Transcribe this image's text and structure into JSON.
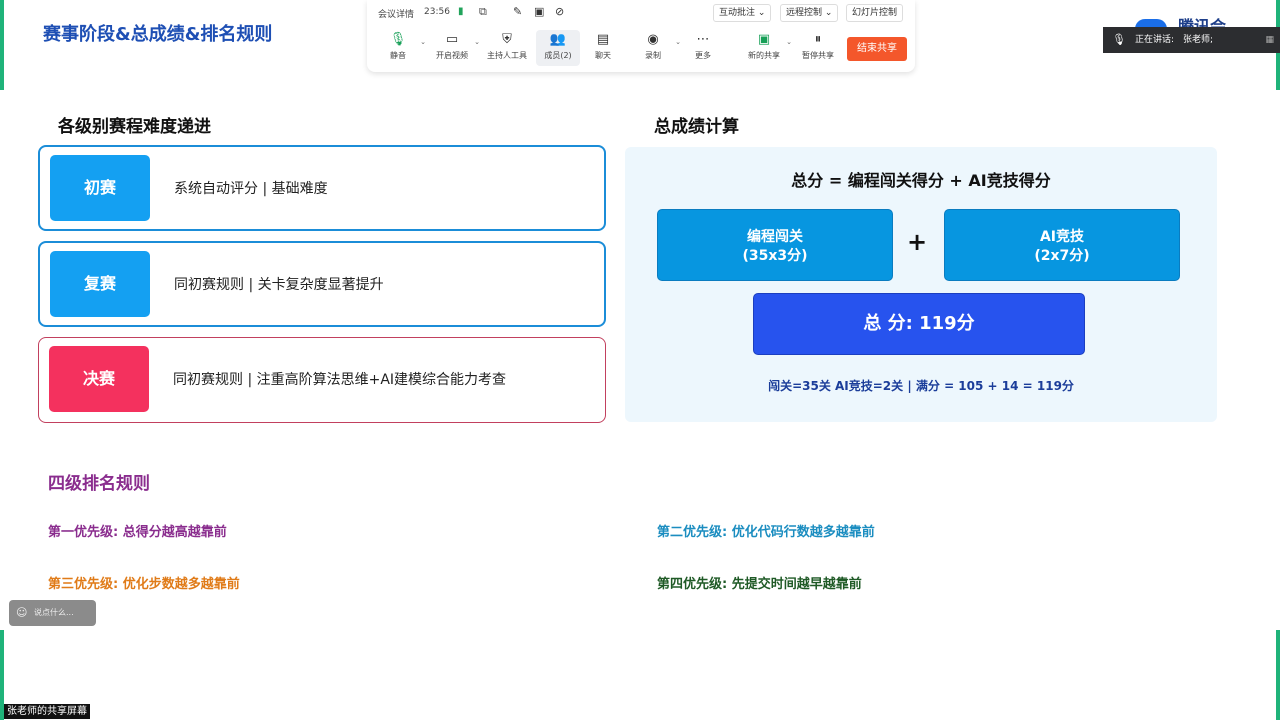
{
  "slide": {
    "title": "赛事阶段&总成绩&排名规则"
  },
  "toolbar": {
    "meeting_details": "会议详情",
    "time": "23:56",
    "annotate": "互动批注",
    "remote_control": "远程控制",
    "slideshow_control": "幻灯片控制",
    "buttons": [
      {
        "label": "静音",
        "icon": "mic-icon"
      },
      {
        "label": "开启视频",
        "icon": "video-off-icon"
      },
      {
        "label": "主持人工具",
        "icon": "shield-icon"
      },
      {
        "label": "成员(2)",
        "icon": "members-icon"
      },
      {
        "label": "聊天",
        "icon": "chat-icon"
      },
      {
        "label": "录制",
        "icon": "record-icon"
      },
      {
        "label": "更多",
        "icon": "more-icon"
      },
      {
        "label": "新的共享",
        "icon": "share-screen-icon"
      },
      {
        "label": "暂停共享",
        "icon": "pause-share-icon"
      }
    ],
    "end_share": "结束共享"
  },
  "speaker": {
    "label": "正在讲话:",
    "name": "张老师;"
  },
  "stages": {
    "heading": "各级别赛程难度递进",
    "items": [
      {
        "tag": "初赛",
        "desc": "系统自动评分 | 基础难度"
      },
      {
        "tag": "复赛",
        "desc": "同初赛规则 | 关卡复杂度显著提升"
      },
      {
        "tag": "决赛",
        "desc": "同初赛规则 | 注重高阶算法思维+AI建模综合能力考查"
      }
    ]
  },
  "score": {
    "heading": "总成绩计算",
    "formula": "总分 = 编程闯关得分 + AI竞技得分",
    "box1_line1": "编程闯关",
    "box1_line2": "(35x3分)",
    "plus": "+",
    "box2_line1": "AI竞技",
    "box2_line2": "(2x7分)",
    "total": "总 分: 119分",
    "note": "闯关=35关  AI竞技=2关  |  满分 = 105 + 14 = 119分"
  },
  "ranking": {
    "title": "四级排名规则",
    "rules": [
      {
        "text": "第一优先级: 总得分越高越靠前",
        "color": "#8a2d8e"
      },
      {
        "text": "第二优先级: 优化代码行数越多越靠前",
        "color": "#1b8dc0"
      },
      {
        "text": "第三优先级: 优化步数越多越靠前",
        "color": "#e07b18"
      },
      {
        "text": "第四优先级: 先提交时间越早越靠前",
        "color": "#1f5a26"
      }
    ]
  },
  "chat": {
    "placeholder": "说点什么..."
  },
  "share_label": "张老师的共享屏幕"
}
